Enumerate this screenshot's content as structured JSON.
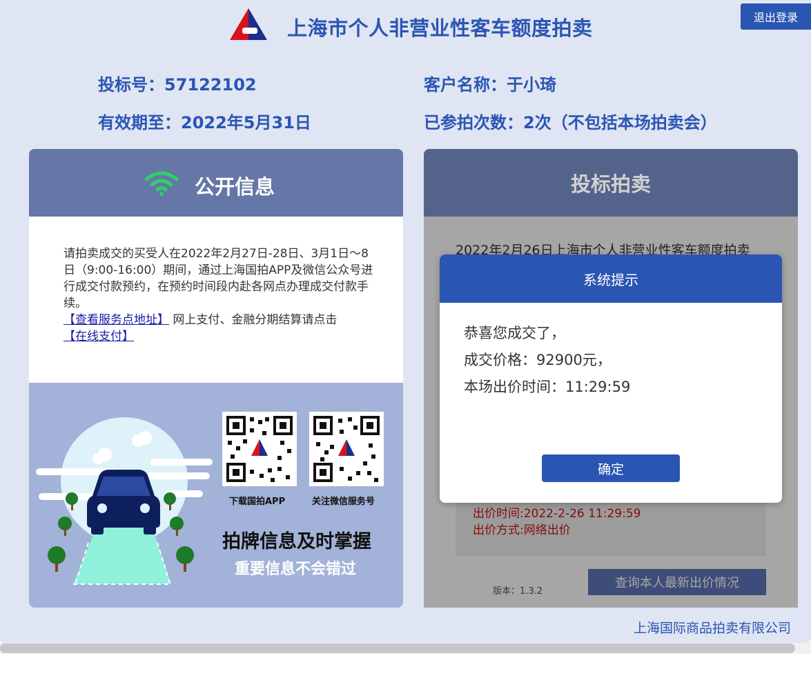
{
  "header": {
    "title": "上海市个人非营业性客车额度拍卖",
    "logout": "退出登录"
  },
  "info": {
    "bid_no": "投标号：57122102",
    "valid_until": "有效期至：2022年5月31日",
    "customer": "客户名称：于小琦",
    "participation": "已参拍次数：2次（不包括本场拍卖会）"
  },
  "left_panel": {
    "title": "公开信息",
    "notice_text": "请拍卖成交的买受人在2022年2月27日-28日、3月1日～8日（9:00-16:00）期间，通过上海国拍APP及微信公众号进行成交付款预约，在预约时间段内赴各网点办理成交付款手续。",
    "service_link": "【查看服务点地址】",
    "pay_text": " 网上支付、金融分期结算请点击",
    "pay_link": "【在线支付】",
    "qr_app_label": "下载国拍APP",
    "qr_wechat_label": "关注微信服务号",
    "promo_main": "拍牌信息及时掌握",
    "promo_sub": "重要信息不会错过"
  },
  "right_panel": {
    "title": "投标拍卖",
    "auction_line": "2022年2月26日上海市个人非营业性客车额度拍卖",
    "bid_time": "出价时间:2022-2-26 11:29:59",
    "bid_method": "出价方式:网络出价",
    "version": "版本：1.3.2",
    "query_button": "查询本人最新出价情况"
  },
  "modal": {
    "title": "系统提示",
    "line1": "恭喜您成交了，",
    "line2": "成交价格：92900元，",
    "line3": "本场出价时间：11:29:59",
    "confirm": "确定"
  },
  "footer": {
    "company": "上海国际商品拍卖有限公司"
  }
}
